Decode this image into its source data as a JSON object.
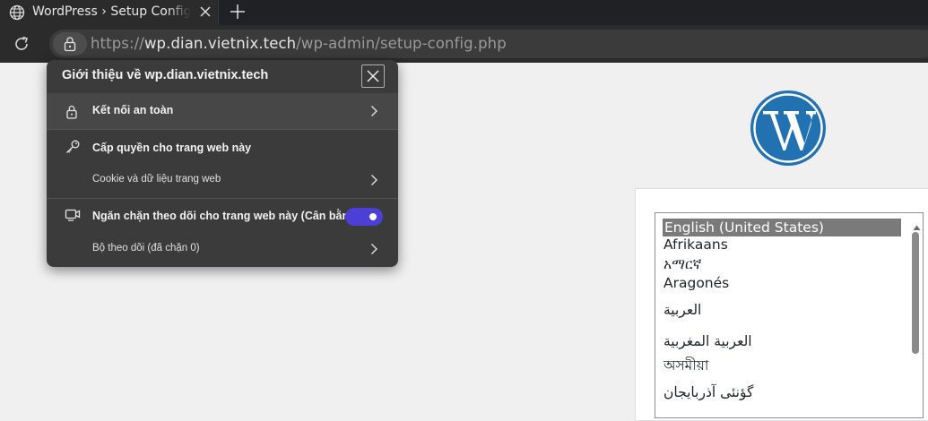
{
  "browser": {
    "tab": {
      "title": "WordPress › Setup Configuration File"
    },
    "url": {
      "scheme": "https://",
      "host": "wp.dian.vietnix.tech",
      "path": "/wp-admin/setup-config.php"
    }
  },
  "site_info_popup": {
    "title": "Giới thiệu về wp.dian.vietnix.tech",
    "secure_connection": "Kết nối an toàn",
    "permissions": "Cấp quyền cho trang web này",
    "cookies": "Cookie và dữ liệu trang web",
    "tracking_prevention": "Ngăn chặn theo dõi cho trang web này (Cân bằng)",
    "tracking_prevention_enabled": true,
    "trackers": "Bộ theo dõi (đã chặn 0)"
  },
  "wordpress": {
    "languages": [
      "English (United States)",
      "Afrikaans",
      "አማርኛ",
      "Aragonés",
      "العربية",
      "العربية المغربية",
      "অসমীয়া",
      "گؤنئی آذربایجان"
    ],
    "selected_language": "English (United States)"
  },
  "colors": {
    "toggle_on": "#4b3fd6",
    "wordpress_blue": "#2271b1"
  }
}
